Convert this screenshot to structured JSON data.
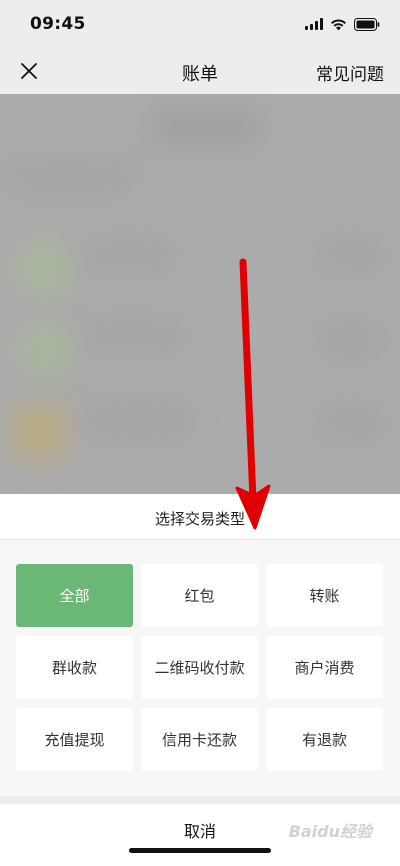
{
  "status_bar": {
    "time": "09:45"
  },
  "nav": {
    "title": "账单",
    "faq_label": "常见问题"
  },
  "sheet": {
    "title": "选择交易类型",
    "types": [
      {
        "label": "全部",
        "selected": true
      },
      {
        "label": "红包",
        "selected": false
      },
      {
        "label": "转账",
        "selected": false
      },
      {
        "label": "群收款",
        "selected": false
      },
      {
        "label": "二维码收付款",
        "selected": false
      },
      {
        "label": "商户消费",
        "selected": false
      },
      {
        "label": "充值提现",
        "selected": false
      },
      {
        "label": "信用卡还款",
        "selected": false
      },
      {
        "label": "有退款",
        "selected": false
      }
    ],
    "cancel_label": "取消"
  },
  "watermark": "Baidu经验",
  "colors": {
    "accent": "#6bb876",
    "annotation_arrow": "#e00000"
  },
  "icons": [
    "close-icon",
    "signal-icon",
    "wifi-icon",
    "battery-icon",
    "arrow-annotation"
  ]
}
